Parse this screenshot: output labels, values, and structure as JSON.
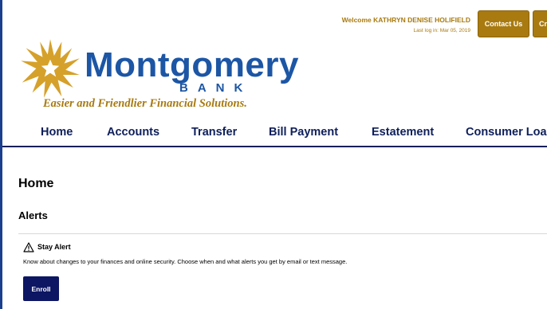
{
  "header": {
    "welcome_prefix": "Welcome",
    "user_name": "KATHRYN DENISE HOLIFIELD",
    "last_login": "Last log in: Mar 05, 2019",
    "contact_label": "Contact Us",
    "cut_button_label": "Cr"
  },
  "logo": {
    "name": "Montgomery",
    "bank": "BANK",
    "tagline": "Easier and Friendlier Financial Solutions.",
    "icon": "sunburst-logo-icon"
  },
  "nav": {
    "items": [
      {
        "label": "Home"
      },
      {
        "label": "Accounts"
      },
      {
        "label": "Transfer"
      },
      {
        "label": "Bill Payment"
      },
      {
        "label": "Estatement"
      },
      {
        "label": "Consumer Loan"
      }
    ]
  },
  "main": {
    "page_title": "Home",
    "section_title": "Alerts",
    "alert": {
      "icon": "warning-icon",
      "title": "Stay Alert",
      "description": "Know about changes to your finances and online security. Choose when and what alerts you get by email or text message.",
      "enroll_label": "Enroll"
    }
  },
  "colors": {
    "gold": "#a87a10",
    "logo_blue": "#1c56a5",
    "navy": "#0e1f5a",
    "button_navy": "#0d1663"
  }
}
